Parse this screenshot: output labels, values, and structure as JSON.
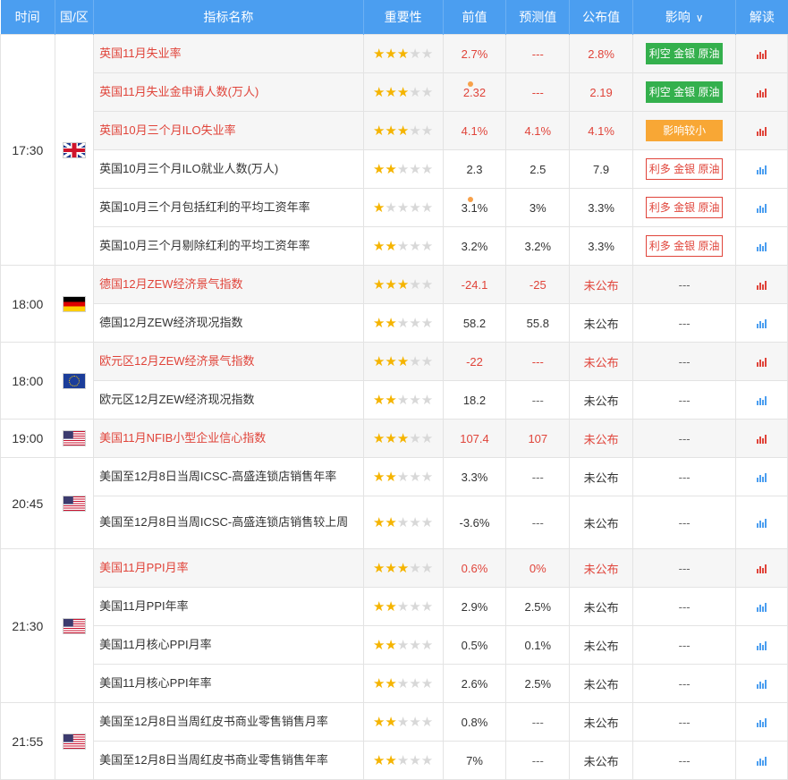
{
  "header": {
    "time": "时间",
    "region": "国/区",
    "indicator": "指标名称",
    "importance": "重要性",
    "previous": "前值",
    "forecast": "预测值",
    "actual": "公布值",
    "impact": "影响",
    "interpret": "解读"
  },
  "colors": {
    "header_bg": "#4b9ef0",
    "highlight": "#e0443a",
    "star": "#f5b400",
    "green": "#34b04d",
    "orange": "#f8a735",
    "chart_red": "#e0443a",
    "chart_blue": "#4b9ef0"
  },
  "groups": [
    {
      "time": "17:30",
      "flag": "gb",
      "rows": [
        {
          "name": "英国11月失业率",
          "stars": 3,
          "prev": "2.7%",
          "prev_dot": false,
          "forecast": "---",
          "actual": "2.8%",
          "impact": "利空 金银 原油",
          "impact_style": "green",
          "hl": true,
          "chart": "red"
        },
        {
          "name": "英国11月失业金申请人数(万人)",
          "stars": 3,
          "prev": "2.32",
          "prev_dot": true,
          "forecast": "---",
          "actual": "2.19",
          "impact": "利空 金银 原油",
          "impact_style": "green",
          "hl": true,
          "chart": "red"
        },
        {
          "name": "英国10月三个月ILO失业率",
          "stars": 3,
          "prev": "4.1%",
          "prev_dot": false,
          "forecast": "4.1%",
          "actual": "4.1%",
          "impact": "影响较小",
          "impact_style": "orange",
          "hl": true,
          "chart": "red"
        },
        {
          "name": "英国10月三个月ILO就业人数(万人)",
          "stars": 2,
          "prev": "2.3",
          "prev_dot": false,
          "forecast": "2.5",
          "actual": "7.9",
          "impact": "利多 金银 原油",
          "impact_style": "outline",
          "hl": false,
          "chart": "blue"
        },
        {
          "name": "英国10月三个月包括红利的平均工资年率",
          "stars": 1,
          "prev": "3.1%",
          "prev_dot": true,
          "forecast": "3%",
          "actual": "3.3%",
          "impact": "利多 金银 原油",
          "impact_style": "outline",
          "hl": false,
          "chart": "blue"
        },
        {
          "name": "英国10月三个月剔除红利的平均工资年率",
          "stars": 2,
          "prev": "3.2%",
          "prev_dot": false,
          "forecast": "3.2%",
          "actual": "3.3%",
          "impact": "利多 金银 原油",
          "impact_style": "outline",
          "hl": false,
          "chart": "blue"
        }
      ]
    },
    {
      "time": "18:00",
      "flag": "de",
      "rows": [
        {
          "name": "德国12月ZEW经济景气指数",
          "stars": 3,
          "prev": "-24.1",
          "prev_dot": false,
          "forecast": "-25",
          "actual": "未公布",
          "impact": "---",
          "impact_style": "dash",
          "hl": true,
          "chart": "red"
        },
        {
          "name": "德国12月ZEW经济现况指数",
          "stars": 2,
          "prev": "58.2",
          "prev_dot": false,
          "forecast": "55.8",
          "actual": "未公布",
          "impact": "---",
          "impact_style": "dash",
          "hl": false,
          "chart": "blue"
        }
      ]
    },
    {
      "time": "18:00",
      "flag": "eu",
      "rows": [
        {
          "name": "欧元区12月ZEW经济景气指数",
          "stars": 3,
          "prev": "-22",
          "prev_dot": false,
          "forecast": "---",
          "actual": "未公布",
          "impact": "---",
          "impact_style": "dash",
          "hl": true,
          "chart": "red"
        },
        {
          "name": "欧元区12月ZEW经济现况指数",
          "stars": 2,
          "prev": "18.2",
          "prev_dot": false,
          "forecast": "---",
          "actual": "未公布",
          "impact": "---",
          "impact_style": "dash",
          "hl": false,
          "chart": "blue"
        }
      ]
    },
    {
      "time": "19:00",
      "flag": "us",
      "rows": [
        {
          "name": "美国11月NFIB小型企业信心指数",
          "stars": 3,
          "prev": "107.4",
          "prev_dot": false,
          "forecast": "107",
          "actual": "未公布",
          "impact": "---",
          "impact_style": "dash",
          "hl": true,
          "chart": "red"
        }
      ]
    },
    {
      "time": "20:45",
      "flag": "us",
      "rows": [
        {
          "name": "美国至12月8日当周ICSC-高盛连锁店销售年率",
          "stars": 2,
          "prev": "3.3%",
          "prev_dot": false,
          "forecast": "---",
          "actual": "未公布",
          "impact": "---",
          "impact_style": "dash",
          "hl": false,
          "chart": "blue"
        },
        {
          "name": "美国至12月8日当周ICSC-高盛连锁店销售较上周",
          "stars": 2,
          "prev": "-3.6%",
          "prev_dot": false,
          "forecast": "---",
          "actual": "未公布",
          "impact": "---",
          "impact_style": "dash",
          "hl": false,
          "chart": "blue",
          "tall": true
        }
      ]
    },
    {
      "time": "21:30",
      "flag": "us",
      "rows": [
        {
          "name": "美国11月PPI月率",
          "stars": 3,
          "prev": "0.6%",
          "prev_dot": false,
          "forecast": "0%",
          "actual": "未公布",
          "impact": "---",
          "impact_style": "dash",
          "hl": true,
          "chart": "red"
        },
        {
          "name": "美国11月PPI年率",
          "stars": 2,
          "prev": "2.9%",
          "prev_dot": false,
          "forecast": "2.5%",
          "actual": "未公布",
          "impact": "---",
          "impact_style": "dash",
          "hl": false,
          "chart": "blue"
        },
        {
          "name": "美国11月核心PPI月率",
          "stars": 2,
          "prev": "0.5%",
          "prev_dot": false,
          "forecast": "0.1%",
          "actual": "未公布",
          "impact": "---",
          "impact_style": "dash",
          "hl": false,
          "chart": "blue"
        },
        {
          "name": "美国11月核心PPI年率",
          "stars": 2,
          "prev": "2.6%",
          "prev_dot": false,
          "forecast": "2.5%",
          "actual": "未公布",
          "impact": "---",
          "impact_style": "dash",
          "hl": false,
          "chart": "blue"
        }
      ]
    },
    {
      "time": "21:55",
      "flag": "us",
      "rows": [
        {
          "name": "美国至12月8日当周红皮书商业零售销售月率",
          "stars": 2,
          "prev": "0.8%",
          "prev_dot": false,
          "forecast": "---",
          "actual": "未公布",
          "impact": "---",
          "impact_style": "dash",
          "hl": false,
          "chart": "blue"
        },
        {
          "name": "美国至12月8日当周红皮书商业零售销售年率",
          "stars": 2,
          "prev": "7%",
          "prev_dot": false,
          "forecast": "---",
          "actual": "未公布",
          "impact": "---",
          "impact_style": "dash",
          "hl": false,
          "chart": "blue"
        }
      ]
    }
  ]
}
